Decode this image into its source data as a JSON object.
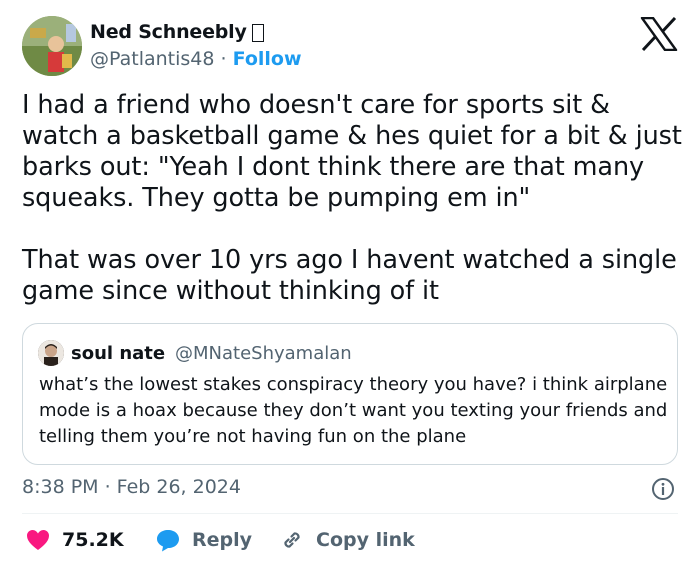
{
  "author": {
    "name": "Ned Schneebly",
    "badge_glyph": "▯",
    "handle": "@Patlantis48",
    "separator": "·",
    "follow_label": "Follow"
  },
  "tweet": {
    "paragraphs": [
      "I had a friend who doesn't care for sports sit & watch a basketball game & hes quiet for a bit & just barks out: \"Yeah I dont think there are that many squeaks. They gotta be pumping em in\"",
      "That was over 10 yrs ago I havent watched a single game since without thinking of it"
    ]
  },
  "quoted": {
    "name": "soul nate",
    "handle": "@MNateShyamalan",
    "text": "what’s the lowest stakes conspiracy theory you have? i think airplane mode is a hoax because they don’t want you texting your friends and telling them you’re not having fun on the plane"
  },
  "timestamp": "8:38 PM · Feb 26, 2024",
  "actions": {
    "likes": "75.2K",
    "reply_label": "Reply",
    "copy_label": "Copy link"
  },
  "icons": {
    "logo": "x-logo-icon",
    "info": "info-icon",
    "like": "heart-icon",
    "reply": "speech-bubble-icon",
    "copy": "link-icon"
  },
  "colors": {
    "accent": "#1d9bf0",
    "like": "#f91880",
    "muted": "#536471",
    "text": "#0f1419",
    "border": "#cfd9de"
  }
}
